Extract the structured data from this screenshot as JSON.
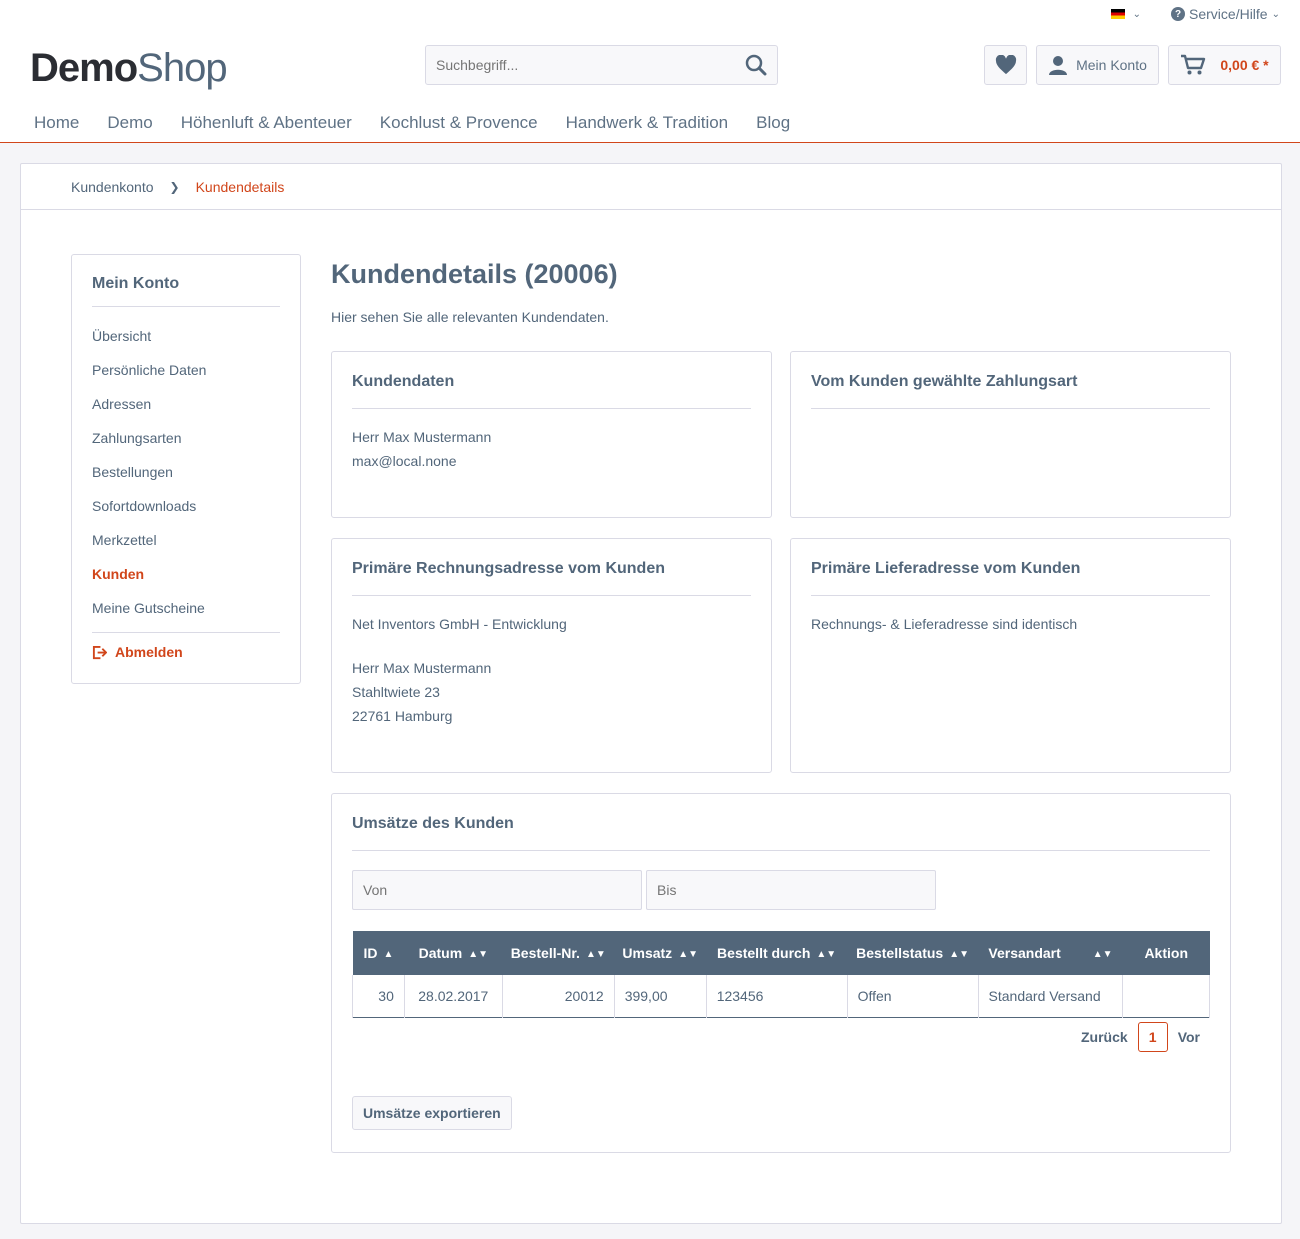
{
  "topbar": {
    "language_icon": "flag-de-icon",
    "service": "Service/Hilfe"
  },
  "logo": {
    "part1": "Demo",
    "part2": "Shop"
  },
  "search": {
    "placeholder": "Suchbegriff..."
  },
  "header": {
    "account": "Mein Konto",
    "cart": "0,00 € *"
  },
  "nav": [
    "Home",
    "Demo",
    "Höhenluft & Abenteuer",
    "Kochlust & Provence",
    "Handwerk & Tradition",
    "Blog"
  ],
  "breadcrumb": {
    "items": [
      "Kundenkonto",
      "Kundendetails"
    ]
  },
  "sidebar": {
    "title": "Mein Konto",
    "items": [
      "Übersicht",
      "Persönliche Daten",
      "Adressen",
      "Zahlungsarten",
      "Bestellungen",
      "Sofortdownloads",
      "Merkzettel",
      "Kunden",
      "Meine Gutscheine"
    ],
    "active": "Kunden",
    "logout": "Abmelden"
  },
  "content": {
    "title": "Kundendetails (20006)",
    "lead": "Hier sehen Sie alle relevanten Kundendaten."
  },
  "customer": {
    "title": "Kundendaten",
    "name": "Herr Max Mustermann",
    "email": "max@local.none"
  },
  "payment": {
    "title": "Vom Kunden gewählte Zahlungsart"
  },
  "billing": {
    "title": "Primäre Rechnungsadresse vom Kunden",
    "company": "Net Inventors GmbH - Entwicklung",
    "name": "Herr Max Mustermann",
    "street": "Stahltwiete 23",
    "city": "22761 Hamburg"
  },
  "shipping": {
    "title": "Primäre Lieferadresse vom Kunden",
    "text": "Rechnungs- & Lieferadresse sind identisch"
  },
  "sales": {
    "title": "Umsätze des Kunden",
    "from_placeholder": "Von",
    "to_placeholder": "Bis",
    "columns": [
      "ID",
      "Datum",
      "Bestell-Nr.",
      "Umsatz",
      "Bestellt durch",
      "Bestellstatus",
      "Versandart",
      "Aktion"
    ],
    "rows": [
      {
        "id": "30",
        "date": "28.02.2017",
        "order": "20012",
        "amount": "399,00",
        "by": "123456",
        "status": "Offen",
        "shipping": "Standard Versand",
        "action": ""
      }
    ],
    "pager": {
      "prev": "Zurück",
      "current": "1",
      "next": "Vor"
    },
    "export": "Umsätze exportieren"
  },
  "colors": {
    "accent": "#d1461b",
    "text": "#52667a",
    "header_bg": "#52667a"
  }
}
